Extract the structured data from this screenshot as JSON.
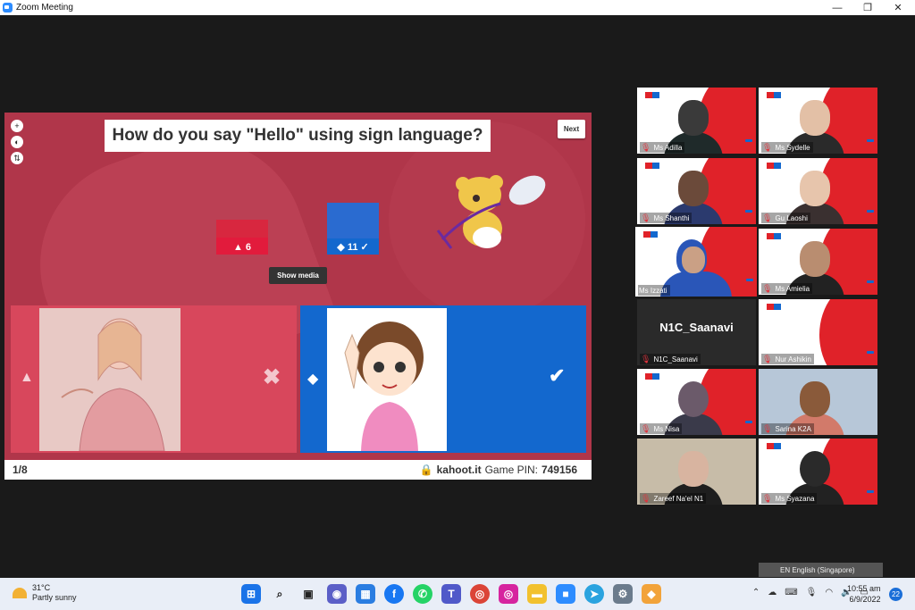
{
  "window": {
    "title": "Zoom Meeting",
    "controls": [
      "—",
      "❐",
      "✕"
    ]
  },
  "share": {
    "question": "How do you say \"Hello\" using sign language?",
    "next_label": "Next",
    "tools": [
      "+",
      "◐",
      "⇅"
    ],
    "answer_counts": [
      {
        "shape": "▲",
        "count": "6",
        "color": "#e21b3c",
        "fraction_of_max": 0.545
      },
      {
        "shape": "◆",
        "count": "11 ✓",
        "color": "#1368ce",
        "fraction_of_max": 1.0
      }
    ],
    "show_media_label": "Show media",
    "answers": [
      {
        "shape": "▲",
        "mark": "✖",
        "correct": false,
        "color": "#d8475c"
      },
      {
        "shape": "◆",
        "mark": "✔",
        "correct": true,
        "color": "#1368ce"
      }
    ],
    "footer": {
      "progress": "1/8",
      "site": "kahoot.it",
      "pin_label": "Game PIN:",
      "pin": "749156"
    }
  },
  "participants": [
    {
      "name": "Ms Adilla",
      "bg": "red",
      "muted": true
    },
    {
      "name": "Ms Sydelle",
      "bg": "red",
      "muted": true
    },
    {
      "name": "Ms Shanthi",
      "bg": "red",
      "muted": true
    },
    {
      "name": "Gu Laoshi",
      "bg": "red",
      "muted": true
    },
    {
      "name": "Ms Izzati",
      "bg": "red",
      "muted": false,
      "active": true
    },
    {
      "name": "Ms Amielia",
      "bg": "red",
      "muted": true
    },
    {
      "name": "N1C_Saanavi",
      "bg": "dark",
      "muted": true,
      "video_off": true
    },
    {
      "name": "Nur Ashikin",
      "bg": "red",
      "muted": true
    },
    {
      "name": "Ms Nisa",
      "bg": "red",
      "muted": true
    },
    {
      "name": "Sarina K2A",
      "bg": "room",
      "muted": true
    },
    {
      "name": "Zareef Na'el N1",
      "bg": "room",
      "muted": true
    },
    {
      "name": "Ms Syazana",
      "bg": "red",
      "muted": true
    }
  ],
  "language_bar": "EN English (Singapore)",
  "taskbar": {
    "weather": {
      "temp": "31°C",
      "desc": "Partly sunny"
    },
    "clock": {
      "time": "10:55 am",
      "date": "6/9/2022"
    },
    "notifications": "22"
  }
}
